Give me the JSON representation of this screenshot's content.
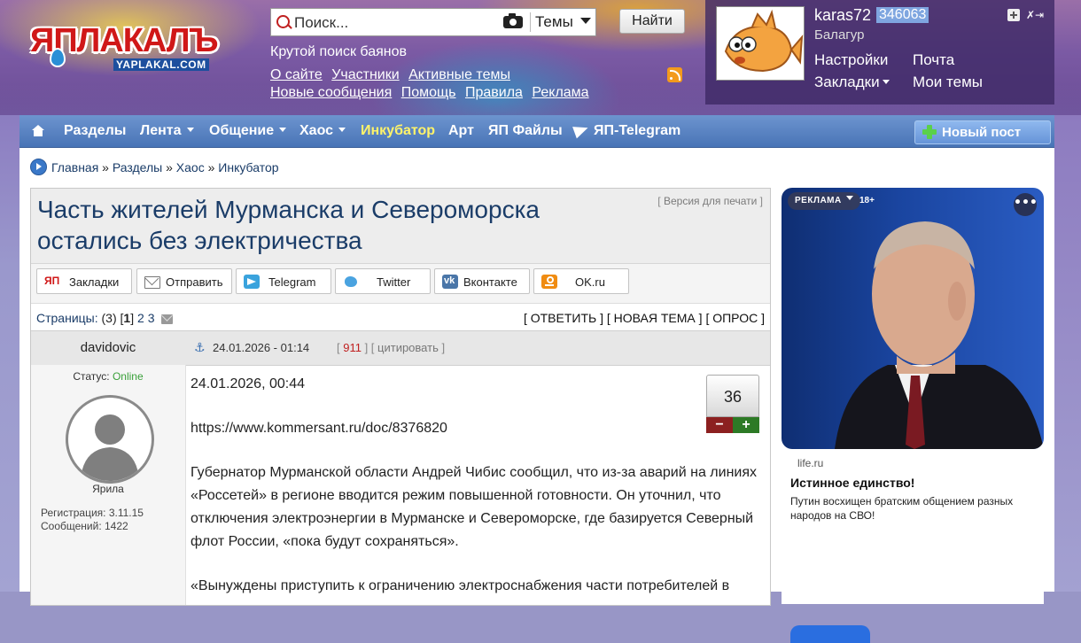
{
  "site": {
    "logo_text": "ЯПЛАКАЛЪ",
    "logo_subtext": "YAPLAKAL.COM",
    "tagline": "Крутой поиск баянов",
    "links": [
      "О сайте",
      "Участники",
      "Активные темы",
      "Новые сообщения",
      "Помощь",
      "Правила",
      "Реклама"
    ]
  },
  "search": {
    "placeholder": "Поиск...",
    "scope": "Темы",
    "button": "Найти"
  },
  "user": {
    "name": "karas72",
    "id": "346063",
    "rank": "Балагур",
    "menu": {
      "settings": "Настройки",
      "mail": "Почта",
      "bookmarks": "Закладки",
      "my_topics": "Мои темы"
    }
  },
  "nav": {
    "items": [
      "Разделы",
      "Лента",
      "Общение",
      "Хаос",
      "Инкубатор",
      "Арт",
      "ЯП Файлы",
      "ЯП-Telegram"
    ],
    "new_post": "Новый пост"
  },
  "breadcrumb": [
    "Главная",
    "Разделы",
    "Хаос",
    "Инкубатор"
  ],
  "topic": {
    "title": "Часть жителей Мурманска и Североморска остались без электричества",
    "print_link": "Версия для печати",
    "share": [
      "Закладки",
      "Отправить",
      "Telegram",
      "Twitter",
      "Вконтакте",
      "OK.ru"
    ],
    "pages_label": "Страницы:",
    "pages_count": "(3)",
    "pages": [
      "1",
      "2",
      "3"
    ],
    "actions": [
      "ОТВЕТИТЬ",
      "НОВАЯ ТЕМА",
      "ОПРОС"
    ]
  },
  "post": {
    "author": "davidovic",
    "datetime": "24.01.2026 - 01:14",
    "number": "911",
    "quote": "цитировать",
    "status_label": "Статус:",
    "status": "Online",
    "author_rank": "Ярила",
    "registered": "Регистрация: 3.11.15",
    "messages": "Сообщений: 1422",
    "rating": "36",
    "body": {
      "date": "24.01.2026, 00:44",
      "link": "https://www.kommersant.ru/doc/8376820",
      "p1": "Губернатор Мурманской области Андрей Чибис сообщил, что из-за аварий на линиях «Россетей» в регионе вводится режим повышенной готовности. Он уточнил, что отключения электроэнергии в Мурманске и Североморске, где базируется Северный флот России, «пока будут сохраняться».",
      "p2": "«Вынуждены приступить к ограничению электроснабжения части потребителей в"
    }
  },
  "ad": {
    "badge": "РЕКЛАМА",
    "age": "18+",
    "source": "life.ru",
    "title": "Истинное единство!",
    "text": "Путин восхищен братским общением разных народов на СВО!"
  }
}
